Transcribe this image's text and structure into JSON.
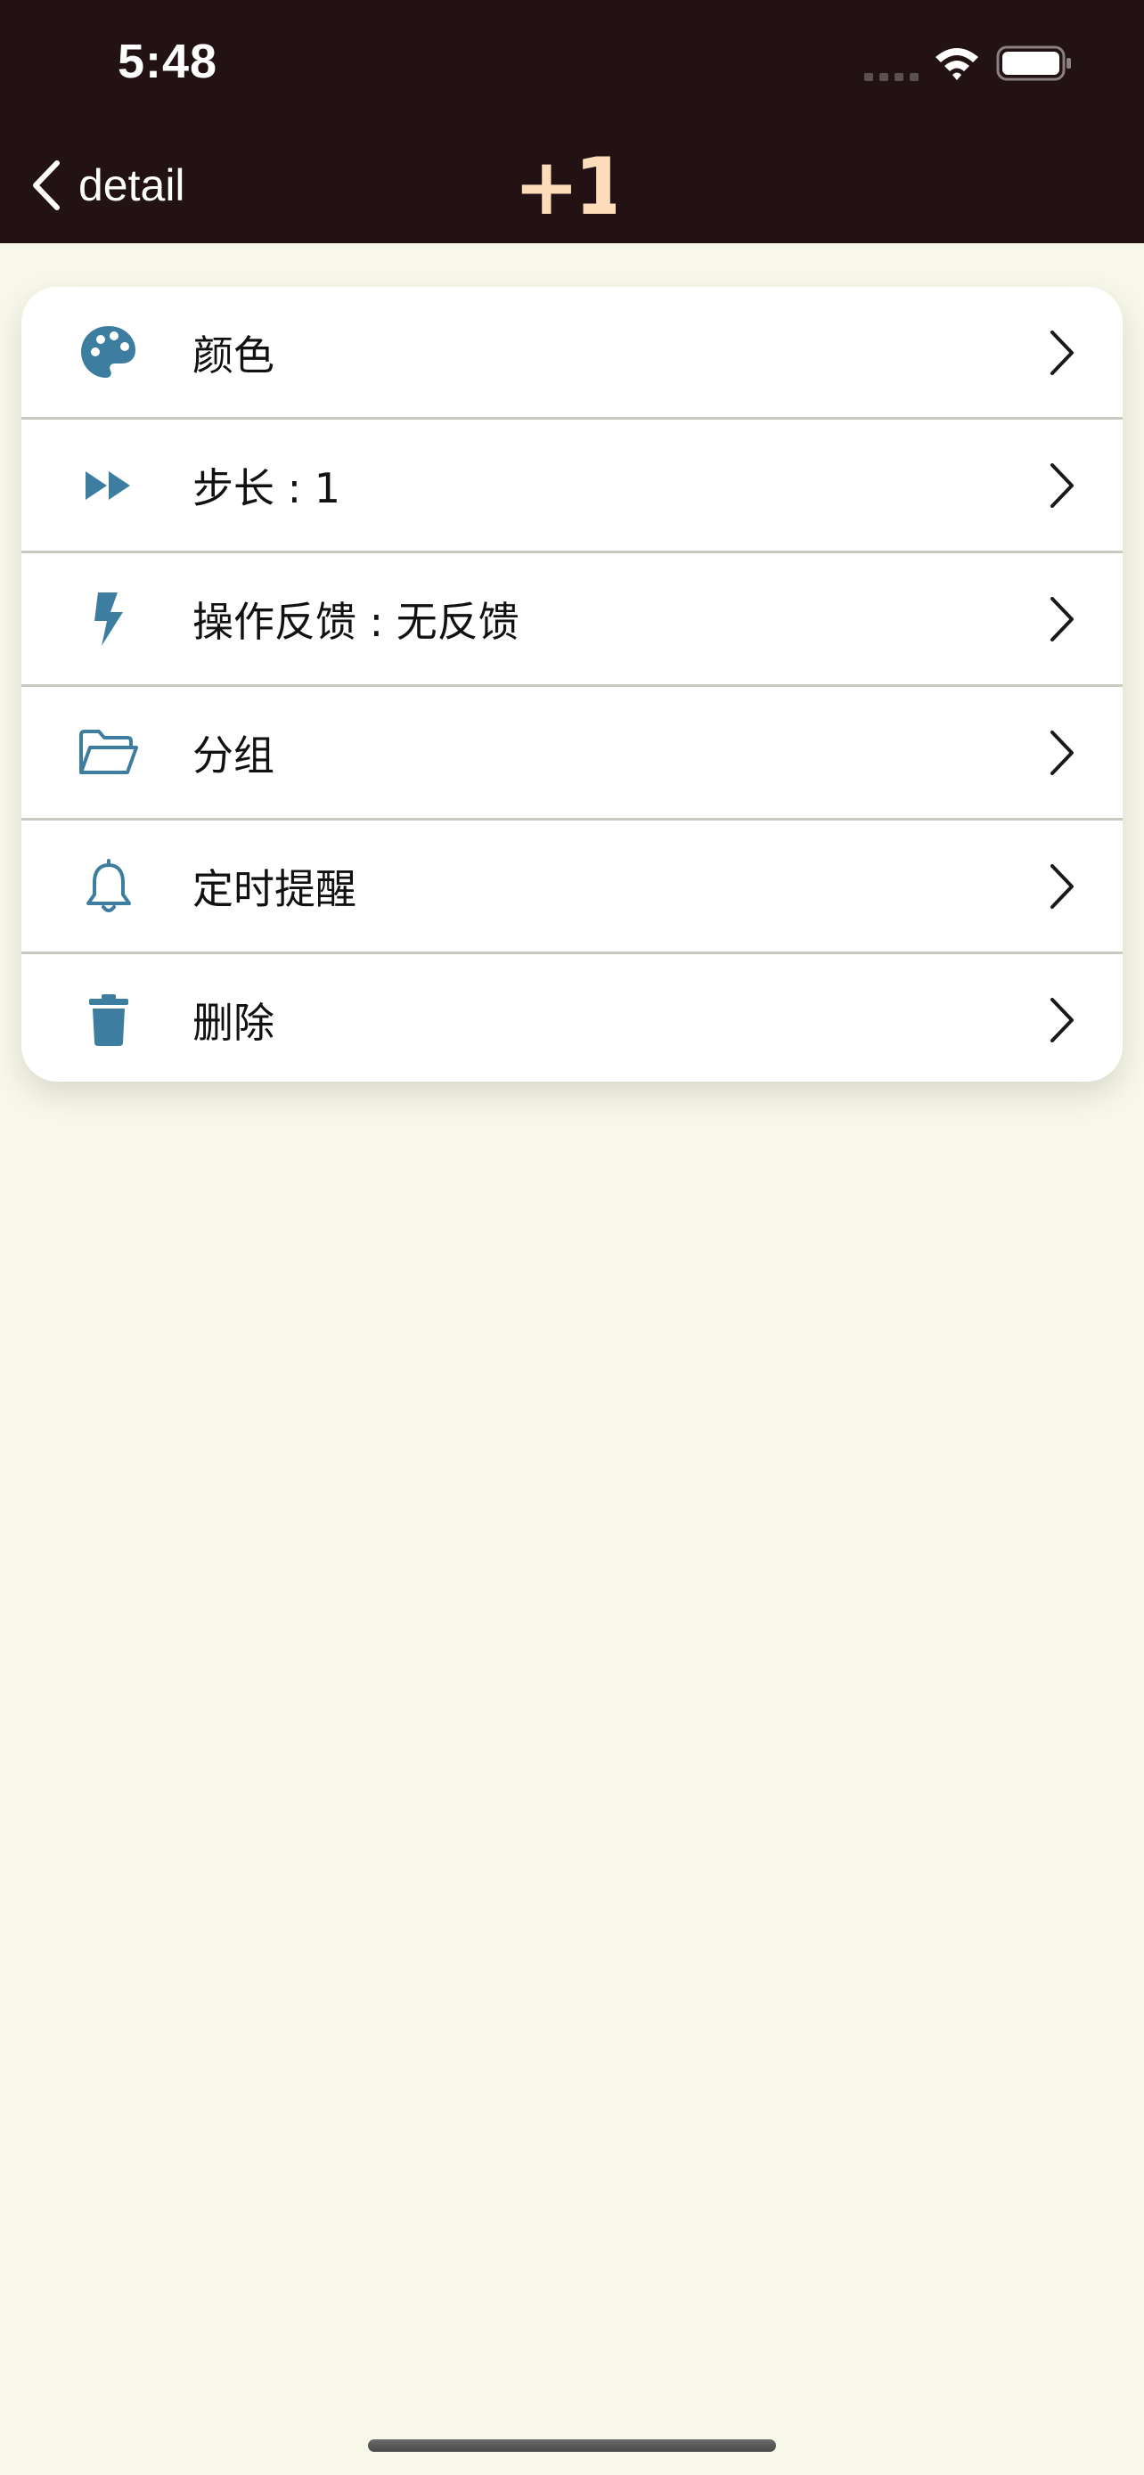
{
  "status_bar": {
    "time": "5:48",
    "icons": [
      "signal-icon",
      "wifi-icon",
      "battery-icon"
    ]
  },
  "nav": {
    "back_label": "detail",
    "back_icon": "chevron-left-icon",
    "logo_text": "+1",
    "logo_color": "#fddcbb"
  },
  "settings": {
    "items": [
      {
        "label": "颜色",
        "icon": "palette-icon"
      },
      {
        "label": "步长 : 1",
        "icon": "fast-forward-icon"
      },
      {
        "label": "操作反馈 : 无反馈",
        "icon": "bolt-icon"
      },
      {
        "label": "分组",
        "icon": "folder-icon"
      },
      {
        "label": "定时提醒",
        "icon": "bell-icon"
      },
      {
        "label": "删除",
        "icon": "trash-icon"
      }
    ]
  },
  "colors": {
    "header_bg": "#221213",
    "page_bg": "#f8f8ea",
    "icon_accent": "#3d7ea0"
  }
}
